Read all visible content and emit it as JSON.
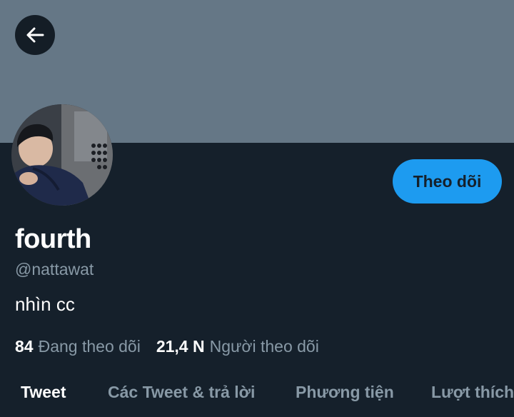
{
  "profile": {
    "display_name": "fourth",
    "handle": "@nattawat",
    "bio": "nhìn cc",
    "follow_label": "Theo dõi",
    "stats": [
      {
        "count": "84",
        "label": "Đang theo dõi"
      },
      {
        "count": "21,4 N",
        "label": "Người theo dõi"
      }
    ]
  },
  "tabs": [
    {
      "label": "Tweet",
      "active": true
    },
    {
      "label": "Các Tweet & trả lời",
      "active": false
    },
    {
      "label": "Phương tiện",
      "active": false
    },
    {
      "label": "Lượt thích",
      "active": false
    }
  ],
  "colors": {
    "background": "#15202b",
    "banner": "#657786",
    "accent": "#1d9bf0",
    "secondary_text": "#8899a6"
  },
  "icons": {
    "back": "arrow-left-icon"
  }
}
